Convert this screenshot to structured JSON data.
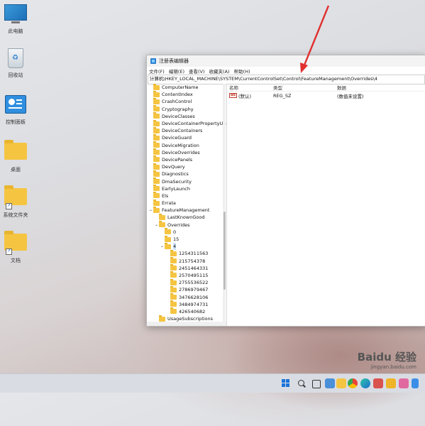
{
  "desktop": {
    "icons": [
      {
        "label": "此电脑",
        "kind": "monitor"
      },
      {
        "label": "回收站",
        "kind": "recycle"
      },
      {
        "label": "控制面板",
        "kind": "control-panel"
      },
      {
        "label": "桌面",
        "kind": "folder"
      },
      {
        "label": "系统文件夹",
        "kind": "folder-shortcut"
      },
      {
        "label": "文档",
        "kind": "folder-shortcut"
      }
    ]
  },
  "regedit": {
    "title": "注册表编辑器",
    "menu": [
      "文件(F)",
      "编辑(E)",
      "查看(V)",
      "收藏夹(A)",
      "帮助(H)"
    ],
    "address": "计算机\\HKEY_LOCAL_MACHINE\\SYSTEM\\CurrentControlSet\\Control\\FeatureManagement\\Overrides\\4",
    "tree": [
      {
        "label": "ComputerName",
        "level": 0
      },
      {
        "label": "ContentIndex",
        "level": 0
      },
      {
        "label": "CrashControl",
        "level": 0
      },
      {
        "label": "Cryptography",
        "level": 0
      },
      {
        "label": "DeviceClasses",
        "level": 0
      },
      {
        "label": "DeviceContainerPropertyUpda",
        "level": 0
      },
      {
        "label": "DeviceContainers",
        "level": 0
      },
      {
        "label": "DeviceGuard",
        "level": 0
      },
      {
        "label": "DeviceMigration",
        "level": 0
      },
      {
        "label": "DeviceOverrides",
        "level": 0
      },
      {
        "label": "DevicePanels",
        "level": 0
      },
      {
        "label": "DevQuery",
        "level": 0
      },
      {
        "label": "Diagnostics",
        "level": 0
      },
      {
        "label": "DmaSecurity",
        "level": 0
      },
      {
        "label": "EarlyLaunch",
        "level": 0
      },
      {
        "label": "Els",
        "level": 0
      },
      {
        "label": "Errata",
        "level": 0
      },
      {
        "label": "FeatureManagement",
        "level": 0,
        "expanded": true
      },
      {
        "label": "LastKnownGood",
        "level": 1
      },
      {
        "label": "Overrides",
        "level": 1,
        "expanded": true
      },
      {
        "label": "0",
        "level": 2
      },
      {
        "label": "15",
        "level": 2
      },
      {
        "label": "4",
        "level": 2,
        "expanded": true,
        "selected": true
      },
      {
        "label": "1254311563",
        "level": 3
      },
      {
        "label": "215754378",
        "level": 3
      },
      {
        "label": "2451464331",
        "level": 3
      },
      {
        "label": "2570495115",
        "level": 3
      },
      {
        "label": "2755536522",
        "level": 3
      },
      {
        "label": "2786979467",
        "level": 3
      },
      {
        "label": "3476628106",
        "level": 3
      },
      {
        "label": "3484974731",
        "level": 3
      },
      {
        "label": "426540682",
        "level": 3
      },
      {
        "label": "UsageSubscriptions",
        "level": 1
      }
    ],
    "columns": [
      "名称",
      "类型",
      "数据"
    ],
    "values": [
      {
        "name": "(默认)",
        "type": "REG_SZ",
        "data": "(数值未设置)"
      }
    ]
  },
  "taskbar": {
    "icons": [
      "start",
      "search",
      "task-view",
      "widgets",
      "file-explorer",
      "chrome",
      "edge",
      "app-red",
      "app-yellow",
      "app-pink",
      "app-blue"
    ]
  },
  "watermark": {
    "brand": "Baidu 经验",
    "url": "jingyan.baidu.com"
  },
  "colors": {
    "accent": "#0067c0",
    "folder": "#f5c542",
    "annotation": "#e03030"
  }
}
